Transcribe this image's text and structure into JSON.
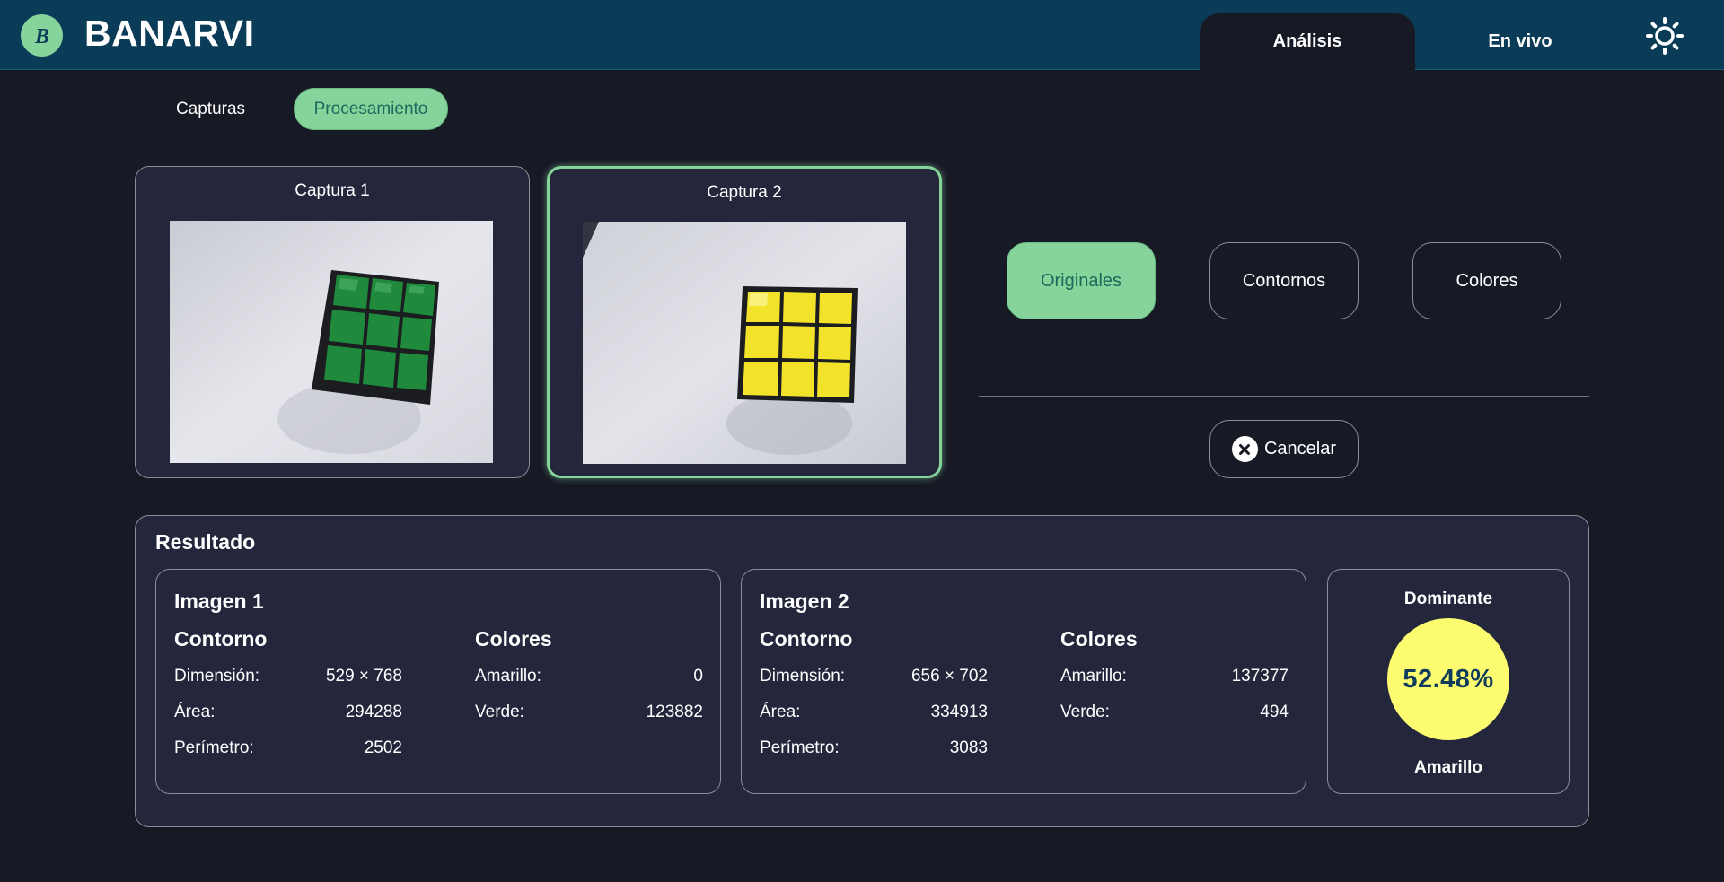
{
  "header": {
    "brand": "BANARVI",
    "logo_letter": "B",
    "nav": [
      {
        "label": "Análisis",
        "active": true
      },
      {
        "label": "En vivo",
        "active": false
      }
    ],
    "theme_icon": "sun-icon"
  },
  "subtabs": [
    {
      "label": "Capturas",
      "active": false
    },
    {
      "label": "Procesamiento",
      "active": true
    }
  ],
  "captures": [
    {
      "title": "Captura 1",
      "selected": false,
      "cube_color": "#1f8a3c"
    },
    {
      "title": "Captura 2",
      "selected": true,
      "cube_color": "#f2e22a"
    }
  ],
  "modes": [
    {
      "label": "Originales",
      "active": true
    },
    {
      "label": "Contornos",
      "active": false
    },
    {
      "label": "Colores",
      "active": false
    }
  ],
  "cancel_label": "Cancelar",
  "result": {
    "title": "Resultado",
    "images": [
      {
        "title": "Imagen 1",
        "contour_heading": "Contorno",
        "colors_heading": "Colores",
        "contour": [
          {
            "label": "Dimensión:",
            "value": "529 × 768"
          },
          {
            "label": "Área:",
            "value": "294288"
          },
          {
            "label": "Perímetro:",
            "value": "2502"
          }
        ],
        "colors": [
          {
            "label": "Amarillo:",
            "value": "0"
          },
          {
            "label": "Verde:",
            "value": "123882"
          }
        ]
      },
      {
        "title": "Imagen 2",
        "contour_heading": "Contorno",
        "colors_heading": "Colores",
        "contour": [
          {
            "label": "Dimensión:",
            "value": "656 × 702"
          },
          {
            "label": "Área:",
            "value": "334913"
          },
          {
            "label": "Perímetro:",
            "value": "3083"
          }
        ],
        "colors": [
          {
            "label": "Amarillo:",
            "value": "137377"
          },
          {
            "label": "Verde:",
            "value": "494"
          }
        ]
      }
    ],
    "dominant": {
      "label": "Dominante",
      "percent": "52.48%",
      "color_name": "Amarillo",
      "color": "#fdfc71"
    }
  },
  "colors": {
    "header_bg": "#0a3b57",
    "page_bg": "#171925",
    "card_bg": "#24273c",
    "accent_green": "#86d39c"
  }
}
